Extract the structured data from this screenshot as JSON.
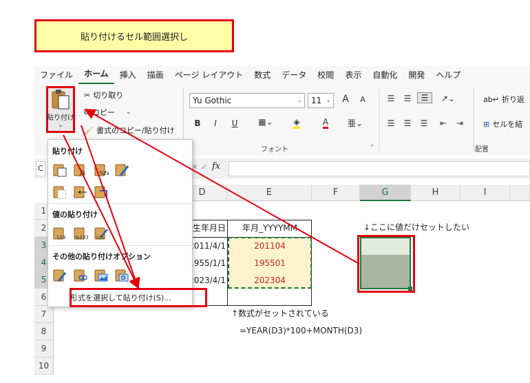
{
  "callout": {
    "title": "貼り付けるセル範囲選択し"
  },
  "ribbon": {
    "tabs": [
      "ファイル",
      "ホーム",
      "挿入",
      "描画",
      "ページ レイアウト",
      "数式",
      "データ",
      "校閲",
      "表示",
      "自動化",
      "開発",
      "ヘルプ"
    ],
    "active_tab": "ホーム",
    "clipboard": {
      "paste_label": "貼り付け",
      "cut_label": "切り取り",
      "copy_label": "コピー",
      "format_painter_label": "書式のコピー/貼り付け"
    },
    "font": {
      "name": "Yu Gothic",
      "size": "11",
      "group_label": "フォント",
      "bold": "B",
      "italic": "I",
      "underline": "U",
      "font_color_glyph": "A",
      "grow_font": "A",
      "shrink_font": "A"
    },
    "alignment": {
      "wrap_label": "折り返",
      "merge_label": "セルを結",
      "group_label": "配置"
    }
  },
  "paste_menu": {
    "section_paste": "貼り付け",
    "section_values": "値の貼り付け",
    "section_other": "その他の貼り付けオプション",
    "special_paste_label": "形式を選択して貼り付け(S)...",
    "value_icon_labels": [
      "123",
      "%123",
      "123"
    ]
  },
  "formula_bar": {
    "fx": "fx",
    "name_box_fragment": "C"
  },
  "sheet": {
    "columns": [
      "D",
      "E",
      "F",
      "G",
      "H",
      "I"
    ],
    "selected_column": "G",
    "rows": [
      "1",
      "2",
      "3",
      "4",
      "5",
      "6",
      "7",
      "8",
      "9",
      "10"
    ],
    "header_d2": "生年月日",
    "header_e2": "年月_YYYYMM",
    "d_values": [
      "2011/4/1",
      "1955/1/1",
      "2023/4/1"
    ],
    "e_values": [
      "201104",
      "195501",
      "202304"
    ],
    "note_g2": "↓ここに値だけセットしたい",
    "note_row7": "↑数式がセットされている",
    "note_row8": "=YEAR(D3)*100+MONTH(D3)"
  },
  "colors": {
    "accent_red": "#e3000f",
    "excel_green": "#1a7a3c",
    "value_red": "#c8232c",
    "copy_fill": "#fff2cc",
    "sel_fill": "#aab6a3",
    "callout_fill": "#ffffa8"
  }
}
